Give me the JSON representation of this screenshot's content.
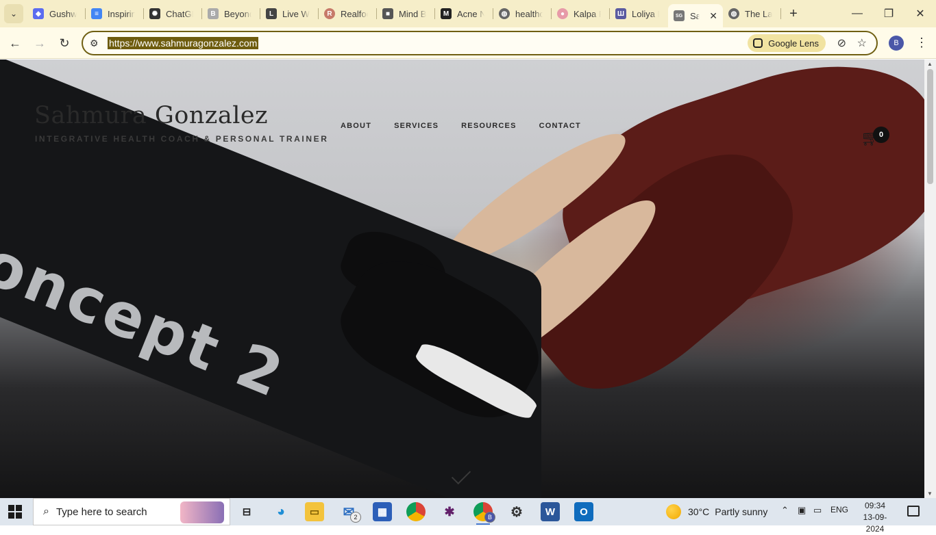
{
  "browser": {
    "tabs": [
      {
        "title": "Gushwork",
        "fav_color": "#5b6cf0",
        "fav_glyph": "◆"
      },
      {
        "title": "Inspiring",
        "fav_color": "#4285f4",
        "fav_glyph": "≡"
      },
      {
        "title": "ChatGPT",
        "fav_color": "#333333",
        "fav_glyph": "✺"
      },
      {
        "title": "Beyond",
        "fav_color": "#aaaaaa",
        "fav_glyph": "B"
      },
      {
        "title": "Live Well",
        "fav_color": "#444444",
        "fav_glyph": "L"
      },
      {
        "title": "Realfood",
        "fav_color": "#c77a6a",
        "fav_glyph": "R"
      },
      {
        "title": "Mind Body",
        "fav_color": "#555555",
        "fav_glyph": "■"
      },
      {
        "title": "Acne N",
        "fav_color": "#222222",
        "fav_glyph": "M"
      },
      {
        "title": "healthc",
        "fav_color": "#666666",
        "fav_glyph": "◍"
      },
      {
        "title": "Kalpa P",
        "fav_color": "#e79aa8",
        "fav_glyph": "●"
      },
      {
        "title": "Loliya H",
        "fav_color": "#5a5aa0",
        "fav_glyph": "Ш"
      },
      {
        "title": "Sahmura Gonzalez",
        "fav_color": "#777777",
        "fav_glyph": "SG",
        "active": true
      },
      {
        "title": "The Lad",
        "fav_color": "#666666",
        "fav_glyph": "◍"
      }
    ],
    "new_tab_label": "+",
    "url": "https://www.sahmuragonzalez.com",
    "google_lens_label": "Google Lens",
    "profile_initial": "B"
  },
  "site": {
    "brand_name": "Sahmura Gonzalez",
    "tagline": "INTEGRATIVE HEALTH COACH & PERSONAL TRAINER",
    "nav": [
      "ABOUT",
      "SERVICES",
      "RESOURCES",
      "CONTACT"
    ],
    "cart_count": "0",
    "hero_machine_text": "oncept 2"
  },
  "taskbar": {
    "search_placeholder": "Type here to search",
    "mail_badge": "2",
    "chrome_profile_badge": "B",
    "weather_temp": "30°C",
    "weather_desc": "Partly sunny",
    "language": "ENG",
    "time": "09:34",
    "date": "13-09-2024"
  },
  "colors": {
    "tab_strip": "#f6eec9",
    "toolbar": "#fffbe9",
    "url_highlight": "#6e5c0e",
    "taskbar": "#dfe6ee"
  }
}
